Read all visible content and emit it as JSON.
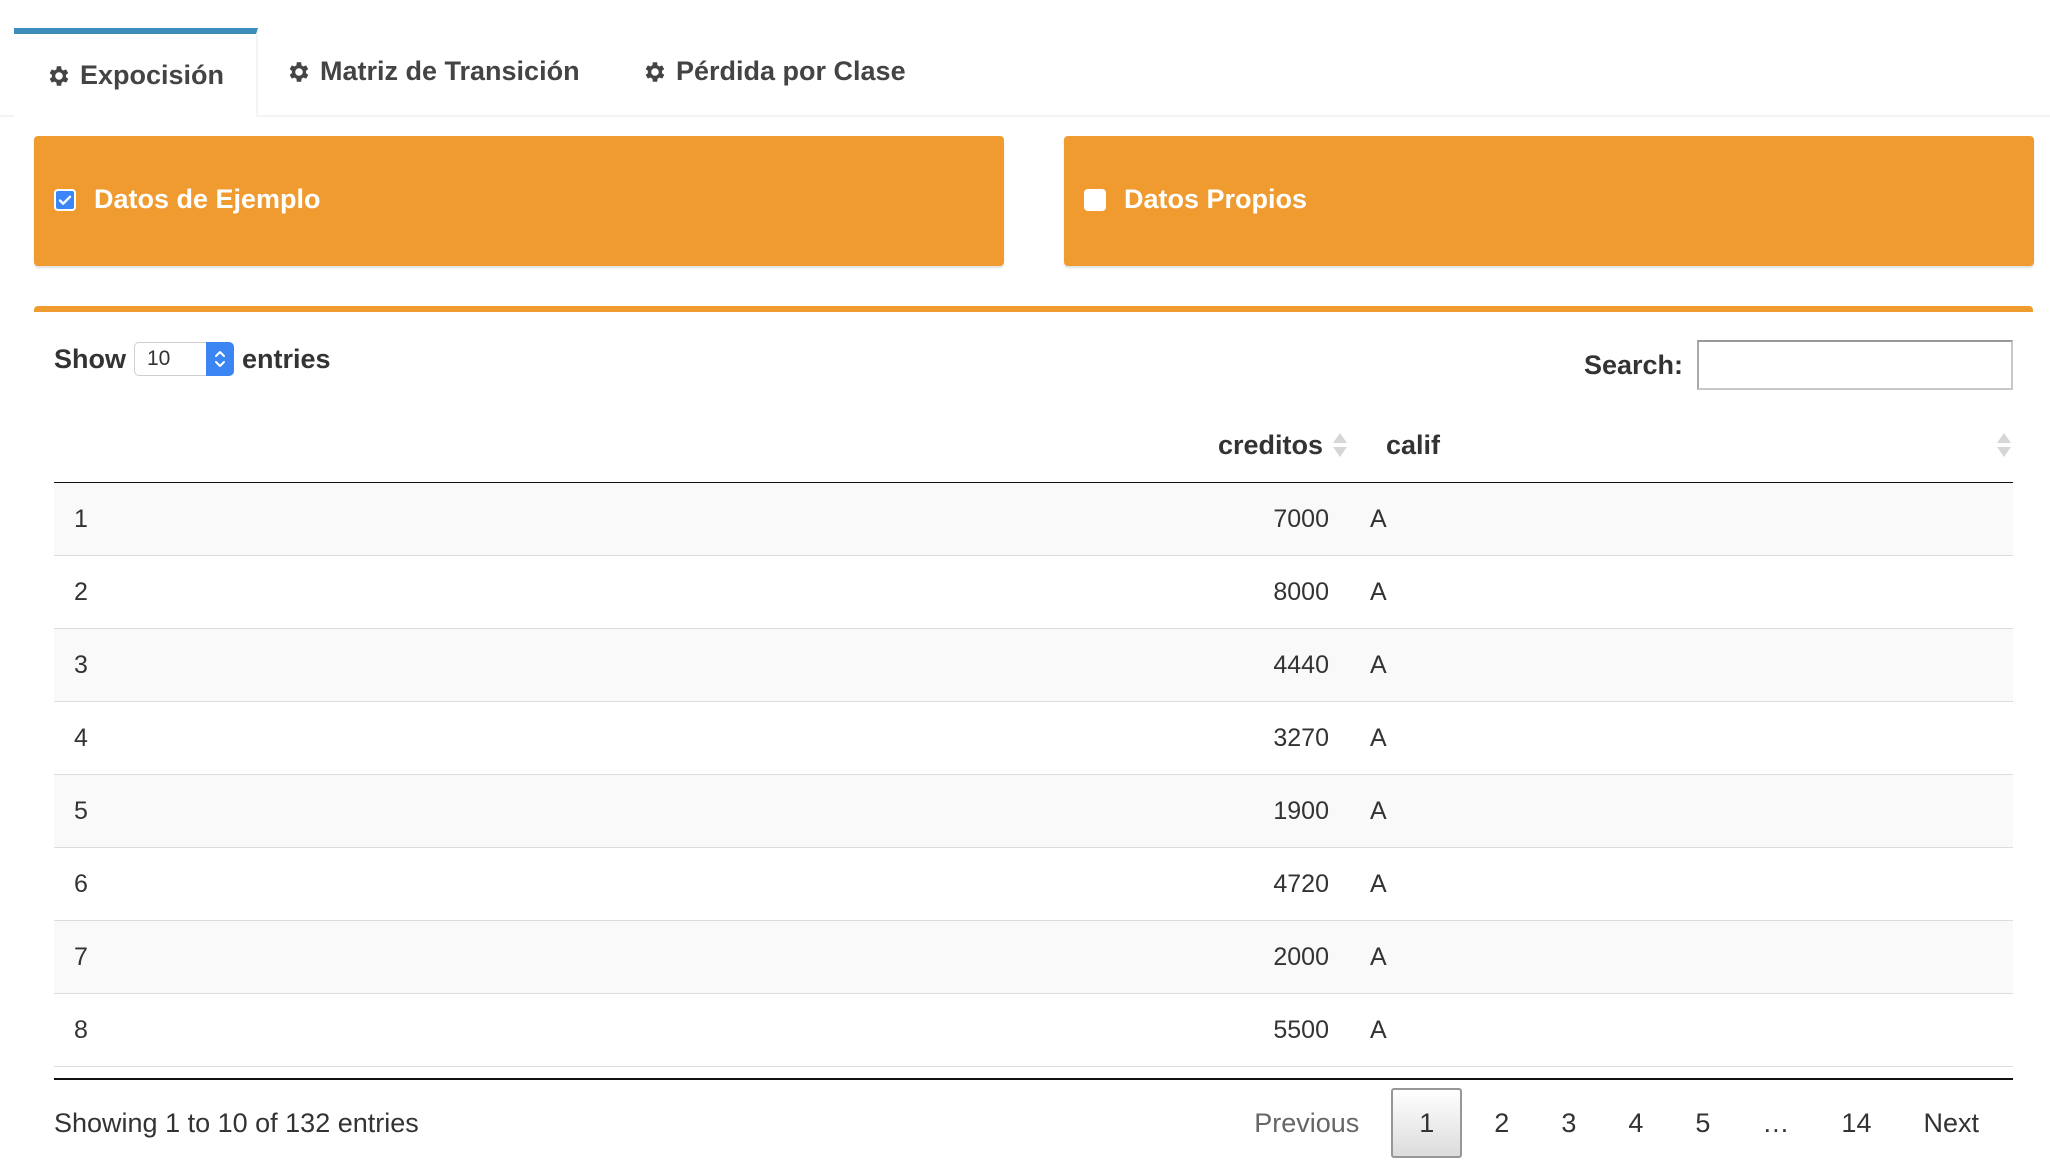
{
  "tabs": [
    {
      "label": "Expocisión",
      "icon": "gear-icon",
      "active": true
    },
    {
      "label": "Matriz de Transición",
      "icon": "gear-icon",
      "active": false
    },
    {
      "label": "Pérdida por Clase",
      "icon": "gear-icon",
      "active": false
    }
  ],
  "options": {
    "example": {
      "label": "Datos de Ejemplo",
      "checked": true
    },
    "own": {
      "label": "Datos Propios",
      "checked": false
    }
  },
  "table": {
    "show_label": "Show",
    "entries_label": "entries",
    "page_length": "10",
    "search_label": "Search:",
    "search_value": "",
    "columns": [
      "",
      "creditos",
      "calif"
    ],
    "rows": [
      {
        "idx": "1",
        "creditos": "7000",
        "calif": "A"
      },
      {
        "idx": "2",
        "creditos": "8000",
        "calif": "A"
      },
      {
        "idx": "3",
        "creditos": "4440",
        "calif": "A"
      },
      {
        "idx": "4",
        "creditos": "3270",
        "calif": "A"
      },
      {
        "idx": "5",
        "creditos": "1900",
        "calif": "A"
      },
      {
        "idx": "6",
        "creditos": "4720",
        "calif": "A"
      },
      {
        "idx": "7",
        "creditos": "2000",
        "calif": "A"
      },
      {
        "idx": "8",
        "creditos": "5500",
        "calif": "A"
      }
    ],
    "info": "Showing 1 to 10 of 132 entries",
    "pagination": {
      "previous": "Previous",
      "next": "Next",
      "pages": [
        "1",
        "2",
        "3",
        "4",
        "5",
        "…",
        "14"
      ],
      "current": "1"
    }
  },
  "colors": {
    "accent_orange": "#f09b2f",
    "tab_active": "#3c8dbc",
    "checkbox": "#3b86f7"
  }
}
